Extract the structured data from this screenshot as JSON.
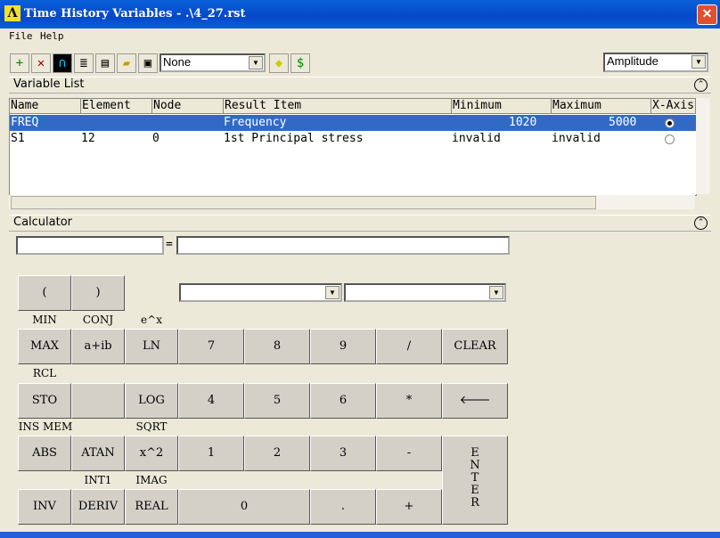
{
  "window": {
    "title": "Time History Variables - .\\4_27.rst",
    "logo": "Λ",
    "close": "✕"
  },
  "menu": [
    "File",
    "Help"
  ],
  "toolbar": {
    "icons": [
      "add-icon",
      "delete-icon",
      "graph-icon",
      "list-icon",
      "properties-icon",
      "open-icon",
      "save-icon"
    ],
    "combo": "None",
    "right_combo": "Amplitude"
  },
  "variable_list": {
    "title": "Variable List",
    "columns": [
      "Name",
      "Element",
      "Node",
      "Result Item",
      "Minimum",
      "Maximum",
      "X-Axis"
    ],
    "rows": [
      {
        "name": "FREQ",
        "element": "",
        "node": "",
        "result": "Frequency",
        "min": "1020",
        "max": "5000",
        "xaxis": true
      },
      {
        "name": "S1",
        "element": "12",
        "node": "0",
        "result": "1st Principal stress",
        "min": "invalid",
        "max": "invalid",
        "xaxis": false
      }
    ]
  },
  "calculator": {
    "title": "Calculator",
    "equals": "=",
    "expr": "",
    "result": "",
    "labels": {
      "min": "MIN",
      "conj": "CONJ",
      "ex": "e^x",
      "rcl": "RCL",
      "insmem": "INS MEM",
      "sqrt": "SQRT",
      "int1": "INT1",
      "imag": "IMAG"
    },
    "buttons": {
      "lp": "(",
      "rp": ")",
      "max": "MAX",
      "aib": "a+ib",
      "ln": "LN",
      "sto": "STO",
      "log": "LOG",
      "abs": "ABS",
      "atan": "ATAN",
      "x2": "x^2",
      "inv": "INV",
      "deriv": "DERIV",
      "real": "REAL",
      "n7": "7",
      "n8": "8",
      "n9": "9",
      "div": "/",
      "clear": "CLEAR",
      "n4": "4",
      "n5": "5",
      "n6": "6",
      "mul": "*",
      "back": "🡐",
      "n1": "1",
      "n2": "2",
      "n3": "3",
      "sub": "-",
      "n0": "0",
      "dot": ".",
      "add": "+",
      "enter": "E N T E R"
    }
  }
}
